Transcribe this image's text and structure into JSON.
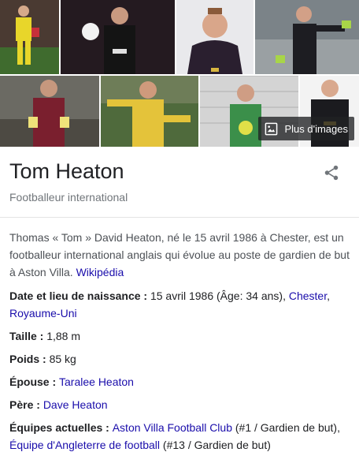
{
  "gallery": {
    "more_images_label": "Plus d'images"
  },
  "header": {
    "title": "Tom Heaton",
    "subtitle": "Footballeur international"
  },
  "description": {
    "text": "Thomas « Tom » David Heaton, né le 15 avril 1986 à Chester, est un footballeur international anglais qui évolue au poste de gardien de but à Aston Villa.",
    "source_link": "Wikipédia"
  },
  "facts": {
    "birth": {
      "label": "Date et lieu de naissance : ",
      "value": "15 avril 1986 (Âge: 34 ans), ",
      "link1": "Chester",
      "sep": ", ",
      "link2": "Royaume-Uni"
    },
    "height": {
      "label": "Taille : ",
      "value": "1,88 m"
    },
    "weight": {
      "label": "Poids : ",
      "value": "85 kg"
    },
    "spouse": {
      "label": "Épouse : ",
      "link": "Taralee Heaton"
    },
    "father": {
      "label": "Père : ",
      "link": "Dave Heaton"
    },
    "teams": {
      "label": "Équipes actuelles : ",
      "link1": "Aston Villa Football Club",
      "value1": " (#1 / Gardien de but),",
      "link2": "Équipe d'Angleterre de football",
      "value2": " (#13 / Gardien de but)"
    }
  },
  "colors": {
    "link": "#1a0dab",
    "subtitle": "#70757a",
    "text": "#202124"
  }
}
